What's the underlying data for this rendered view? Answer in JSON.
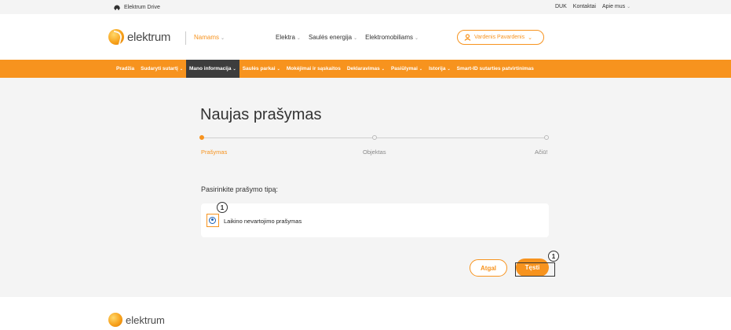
{
  "topbar": {
    "drive_label": "Elektrum Drive",
    "links": [
      "DUK",
      "Kontaktai",
      "Apie mus"
    ]
  },
  "header": {
    "brand": "elektrum",
    "home_label": "Namams",
    "nav": [
      "Elektra",
      "Saulės energija",
      "Elektromobiliams"
    ],
    "user_name": "Vardenis Pavardenis"
  },
  "subnav": {
    "items": [
      {
        "label": "Pradžia",
        "has_chevron": false
      },
      {
        "label": "Sudaryti sutartį",
        "has_chevron": true
      },
      {
        "label": "Mano informacija",
        "has_chevron": true,
        "active": true
      },
      {
        "label": "Saulės parkai",
        "has_chevron": true
      },
      {
        "label": "Mokėjimai ir sąskaitos",
        "has_chevron": false
      },
      {
        "label": "Deklaravimas",
        "has_chevron": true
      },
      {
        "label": "Pasiūlymai",
        "has_chevron": true
      },
      {
        "label": "Istorija",
        "has_chevron": true
      },
      {
        "label": "Smart-ID sutarties patvirtinimas",
        "has_chevron": false
      }
    ]
  },
  "main": {
    "title": "Naujas prašymas",
    "steps": [
      {
        "label": "Prašymas",
        "active": true
      },
      {
        "label": "Objektas",
        "active": false
      },
      {
        "label": "Ačiū!",
        "active": false
      }
    ],
    "section_label": "Pasirinkite prašymo tipą:",
    "option_label": "Laikino nevartojimo prašymas",
    "back_label": "Atgal",
    "next_label": "Tęsti",
    "badges": [
      "1",
      "1"
    ]
  },
  "footer": {
    "brand": "elektrum"
  },
  "colors": {
    "accent": "#f7931e",
    "active_nav": "#3d3d3d",
    "radio": "#1a5fb4"
  }
}
